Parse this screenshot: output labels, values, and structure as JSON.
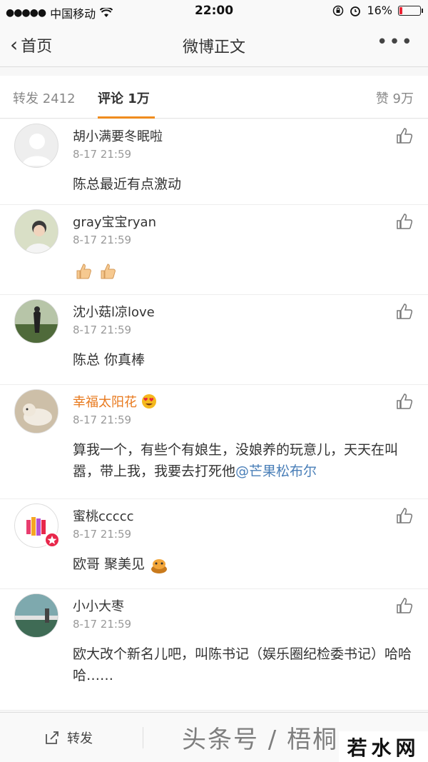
{
  "status": {
    "carrier": "中国移动",
    "time": "22:00",
    "battery": "16%"
  },
  "nav": {
    "back_label": "首页",
    "title": "微博正文",
    "more": "•••"
  },
  "tabs": {
    "repost": "转发 2412",
    "comment": "评论 1万",
    "like": "赞 9万"
  },
  "comments": [
    {
      "name": "胡小满要冬眠啦",
      "time": "8-17 21:59",
      "text": "陈总最近有点激动"
    },
    {
      "name": "gray宝宝ryan",
      "time": "8-17 21:59",
      "text": ""
    },
    {
      "name": "沈小菇l凉love",
      "time": "8-17 21:59",
      "text": "陈总  你真棒"
    },
    {
      "name": "幸福太阳花",
      "time": "8-17 21:59",
      "text": "算我一个，有些个有娘生，没娘养的玩意儿，天天在叫嚣，带上我，我要去打死他",
      "mention": "@芒果松布尔"
    },
    {
      "name": "蜜桃ccccc",
      "time": "8-17 21:59",
      "text": "欧哥  聚美见"
    },
    {
      "name": "小小大枣",
      "time": "8-17 21:59",
      "text": "欧大改个新名儿吧，叫陈书记（娱乐圈纪检委书记）哈哈哈……"
    }
  ],
  "bottom": {
    "repost": "转发",
    "watermark": "头条号 / 梧桐",
    "logo": "若水网"
  },
  "colors": {
    "accent": "#f08c1e",
    "mention": "#4a7fb8",
    "vip_name": "#e8791d"
  }
}
